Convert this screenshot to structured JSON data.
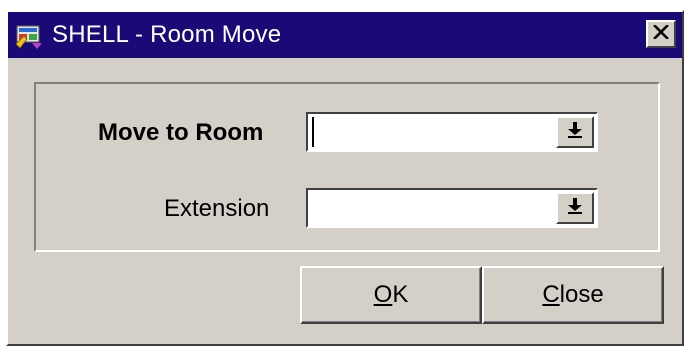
{
  "window": {
    "title": "SHELL - Room Move",
    "colors": {
      "titlebar": "#1a0a78",
      "face": "#d4d0c8"
    },
    "icons": {
      "app": "shell-app-icon",
      "close": "close-icon"
    }
  },
  "form": {
    "move_to_room": {
      "label": "Move to Room",
      "value": "",
      "button_icon": "dropdown-arrow-icon"
    },
    "extension": {
      "label": "Extension",
      "value": "",
      "button_icon": "dropdown-arrow-icon"
    }
  },
  "buttons": {
    "ok": {
      "mnemonic": "O",
      "rest": "K"
    },
    "close": {
      "mnemonic": "C",
      "rest": "lose"
    }
  }
}
